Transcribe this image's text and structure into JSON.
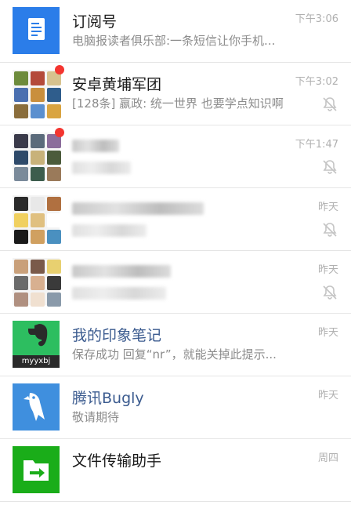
{
  "chats": [
    {
      "title": "订阅号",
      "subtitle": "电脑报读者俱乐部:一条短信让你手机...",
      "time": "下午3:06",
      "avatar": "subscription-icon"
    },
    {
      "title": "安卓黄埔军团",
      "subtitle": "[128条] 嬴政: 统一世界 也要学点知识啊",
      "time": "下午3:02",
      "avatar": "group-avatar",
      "unread": true,
      "muted": true
    },
    {
      "title": "",
      "subtitle": "",
      "time": "下午1:47",
      "avatar": "group-avatar",
      "unread": true,
      "muted": true
    },
    {
      "title": "",
      "subtitle": "",
      "time": "昨天",
      "avatar": "group-avatar",
      "muted": true
    },
    {
      "title": "",
      "subtitle": "",
      "time": "昨天",
      "avatar": "group-avatar",
      "muted": true
    },
    {
      "title": "我的印象笔记",
      "subtitle": "保存成功 回复“nr”，就能关掉此提示...",
      "time": "昨天",
      "avatar": "evernote-icon",
      "avatar_label": "myyxbj"
    },
    {
      "title": "腾讯Bugly",
      "subtitle": "敬请期待",
      "time": "昨天",
      "avatar": "bugly-icon"
    },
    {
      "title": "文件传输助手",
      "subtitle": "",
      "time": "周四",
      "avatar": "file-transfer-icon"
    }
  ],
  "colors": {
    "unread_dot": "#f43530",
    "title_blue": "#3b5b8f",
    "evernote_green": "#2dbe60",
    "bugly_blue": "#3f8fde",
    "file_green": "#1aad19",
    "subscription_blue": "#2b7de9"
  }
}
